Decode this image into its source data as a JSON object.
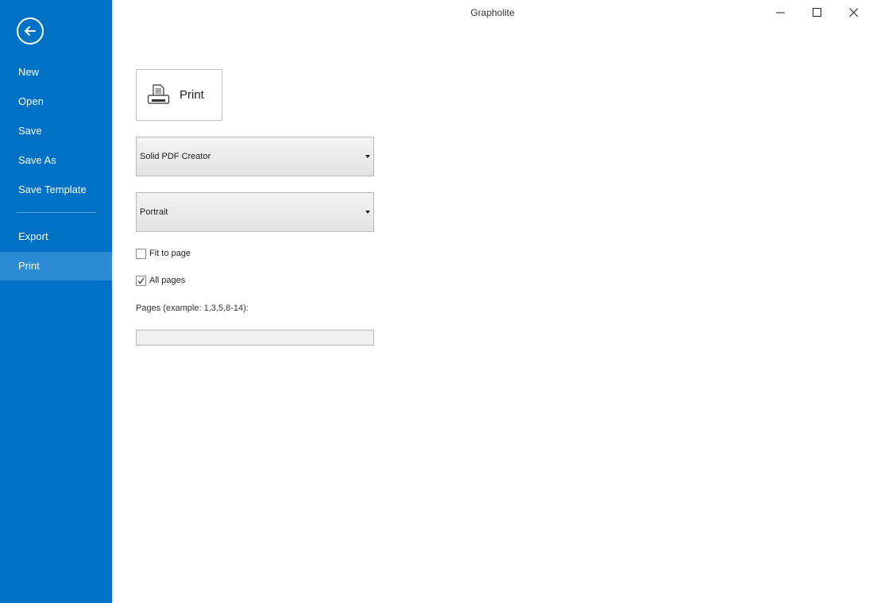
{
  "window": {
    "title": "Grapholite",
    "controls": {
      "minimize": "minimize-icon",
      "maximize": "maximize-icon",
      "close": "close-icon"
    }
  },
  "sidebar": {
    "back_icon": "arrow-left-icon",
    "items": [
      {
        "label": "New"
      },
      {
        "label": "Open"
      },
      {
        "label": "Save"
      },
      {
        "label": "Save As"
      },
      {
        "label": "Save Template"
      },
      {
        "label": "Export"
      },
      {
        "label": "Print",
        "active": true
      }
    ]
  },
  "print_panel": {
    "print_button": {
      "label": "Print",
      "icon": "printer-icon"
    },
    "printer_select": {
      "value": "Solid PDF Creator"
    },
    "orientation_select": {
      "value": "Portrait"
    },
    "fit_to_page": {
      "label": "Fit to page",
      "checked": false
    },
    "all_pages": {
      "label": "All pages",
      "checked": true
    },
    "pages": {
      "label": "Pages (example: 1,3,5,8-14):",
      "value": ""
    }
  },
  "colors": {
    "sidebar_bg": "#0072c6",
    "sidebar_active": "#2a8ad4"
  }
}
